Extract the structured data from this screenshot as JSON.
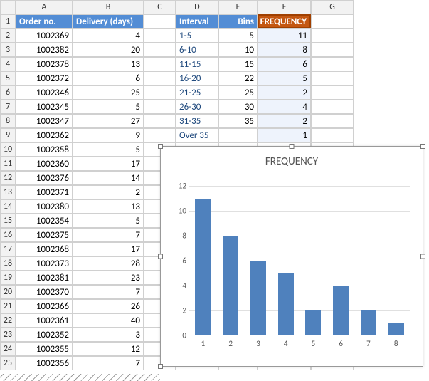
{
  "columns": [
    "",
    "A",
    "B",
    "C",
    "D",
    "E",
    "F",
    "G"
  ],
  "headers": {
    "A": "Order no.",
    "B": "Delivery (days)",
    "D": "Interval",
    "E": "Bins",
    "F": "FREQUENCY"
  },
  "orders": [
    {
      "no": "1002369",
      "days": 4
    },
    {
      "no": "1002382",
      "days": 20
    },
    {
      "no": "1002378",
      "days": 13
    },
    {
      "no": "1002372",
      "days": 6
    },
    {
      "no": "1002346",
      "days": 25
    },
    {
      "no": "1002345",
      "days": 5
    },
    {
      "no": "1002347",
      "days": 27
    },
    {
      "no": "1002362",
      "days": 9
    },
    {
      "no": "1002358",
      "days": 5
    },
    {
      "no": "1002360",
      "days": 17
    },
    {
      "no": "1002376",
      "days": 14
    },
    {
      "no": "1002371",
      "days": 2
    },
    {
      "no": "1002380",
      "days": 13
    },
    {
      "no": "1002354",
      "days": 5
    },
    {
      "no": "1002375",
      "days": 7
    },
    {
      "no": "1002368",
      "days": 17
    },
    {
      "no": "1002373",
      "days": 28
    },
    {
      "no": "1002381",
      "days": 23
    },
    {
      "no": "1002370",
      "days": 7
    },
    {
      "no": "1002366",
      "days": 26
    },
    {
      "no": "1002361",
      "days": 40
    },
    {
      "no": "1002352",
      "days": 3
    },
    {
      "no": "1002355",
      "days": 12
    },
    {
      "no": "1002356",
      "days": 7
    }
  ],
  "freq": [
    {
      "interval": "1-5",
      "bin": 5,
      "value": 11
    },
    {
      "interval": "6-10",
      "bin": 10,
      "value": 8
    },
    {
      "interval": "11-15",
      "bin": 15,
      "value": 6
    },
    {
      "interval": "16-20",
      "bin": 22,
      "value": 5
    },
    {
      "interval": "21-25",
      "bin": 25,
      "value": 2
    },
    {
      "interval": "26-30",
      "bin": 30,
      "value": 4
    },
    {
      "interval": "31-35",
      "bin": 35,
      "value": 2
    },
    {
      "interval": "Over 35",
      "bin": "",
      "value": 1
    }
  ],
  "chart_data": {
    "type": "bar",
    "title": "FREQUENCY",
    "categories": [
      "1",
      "2",
      "3",
      "4",
      "5",
      "6",
      "7",
      "8"
    ],
    "values": [
      11,
      8,
      6,
      5,
      2,
      4,
      2,
      1
    ],
    "ylim": [
      0,
      12
    ],
    "yticks": [
      0,
      2,
      4,
      6,
      8,
      10,
      12
    ],
    "xlabel": "",
    "ylabel": ""
  }
}
